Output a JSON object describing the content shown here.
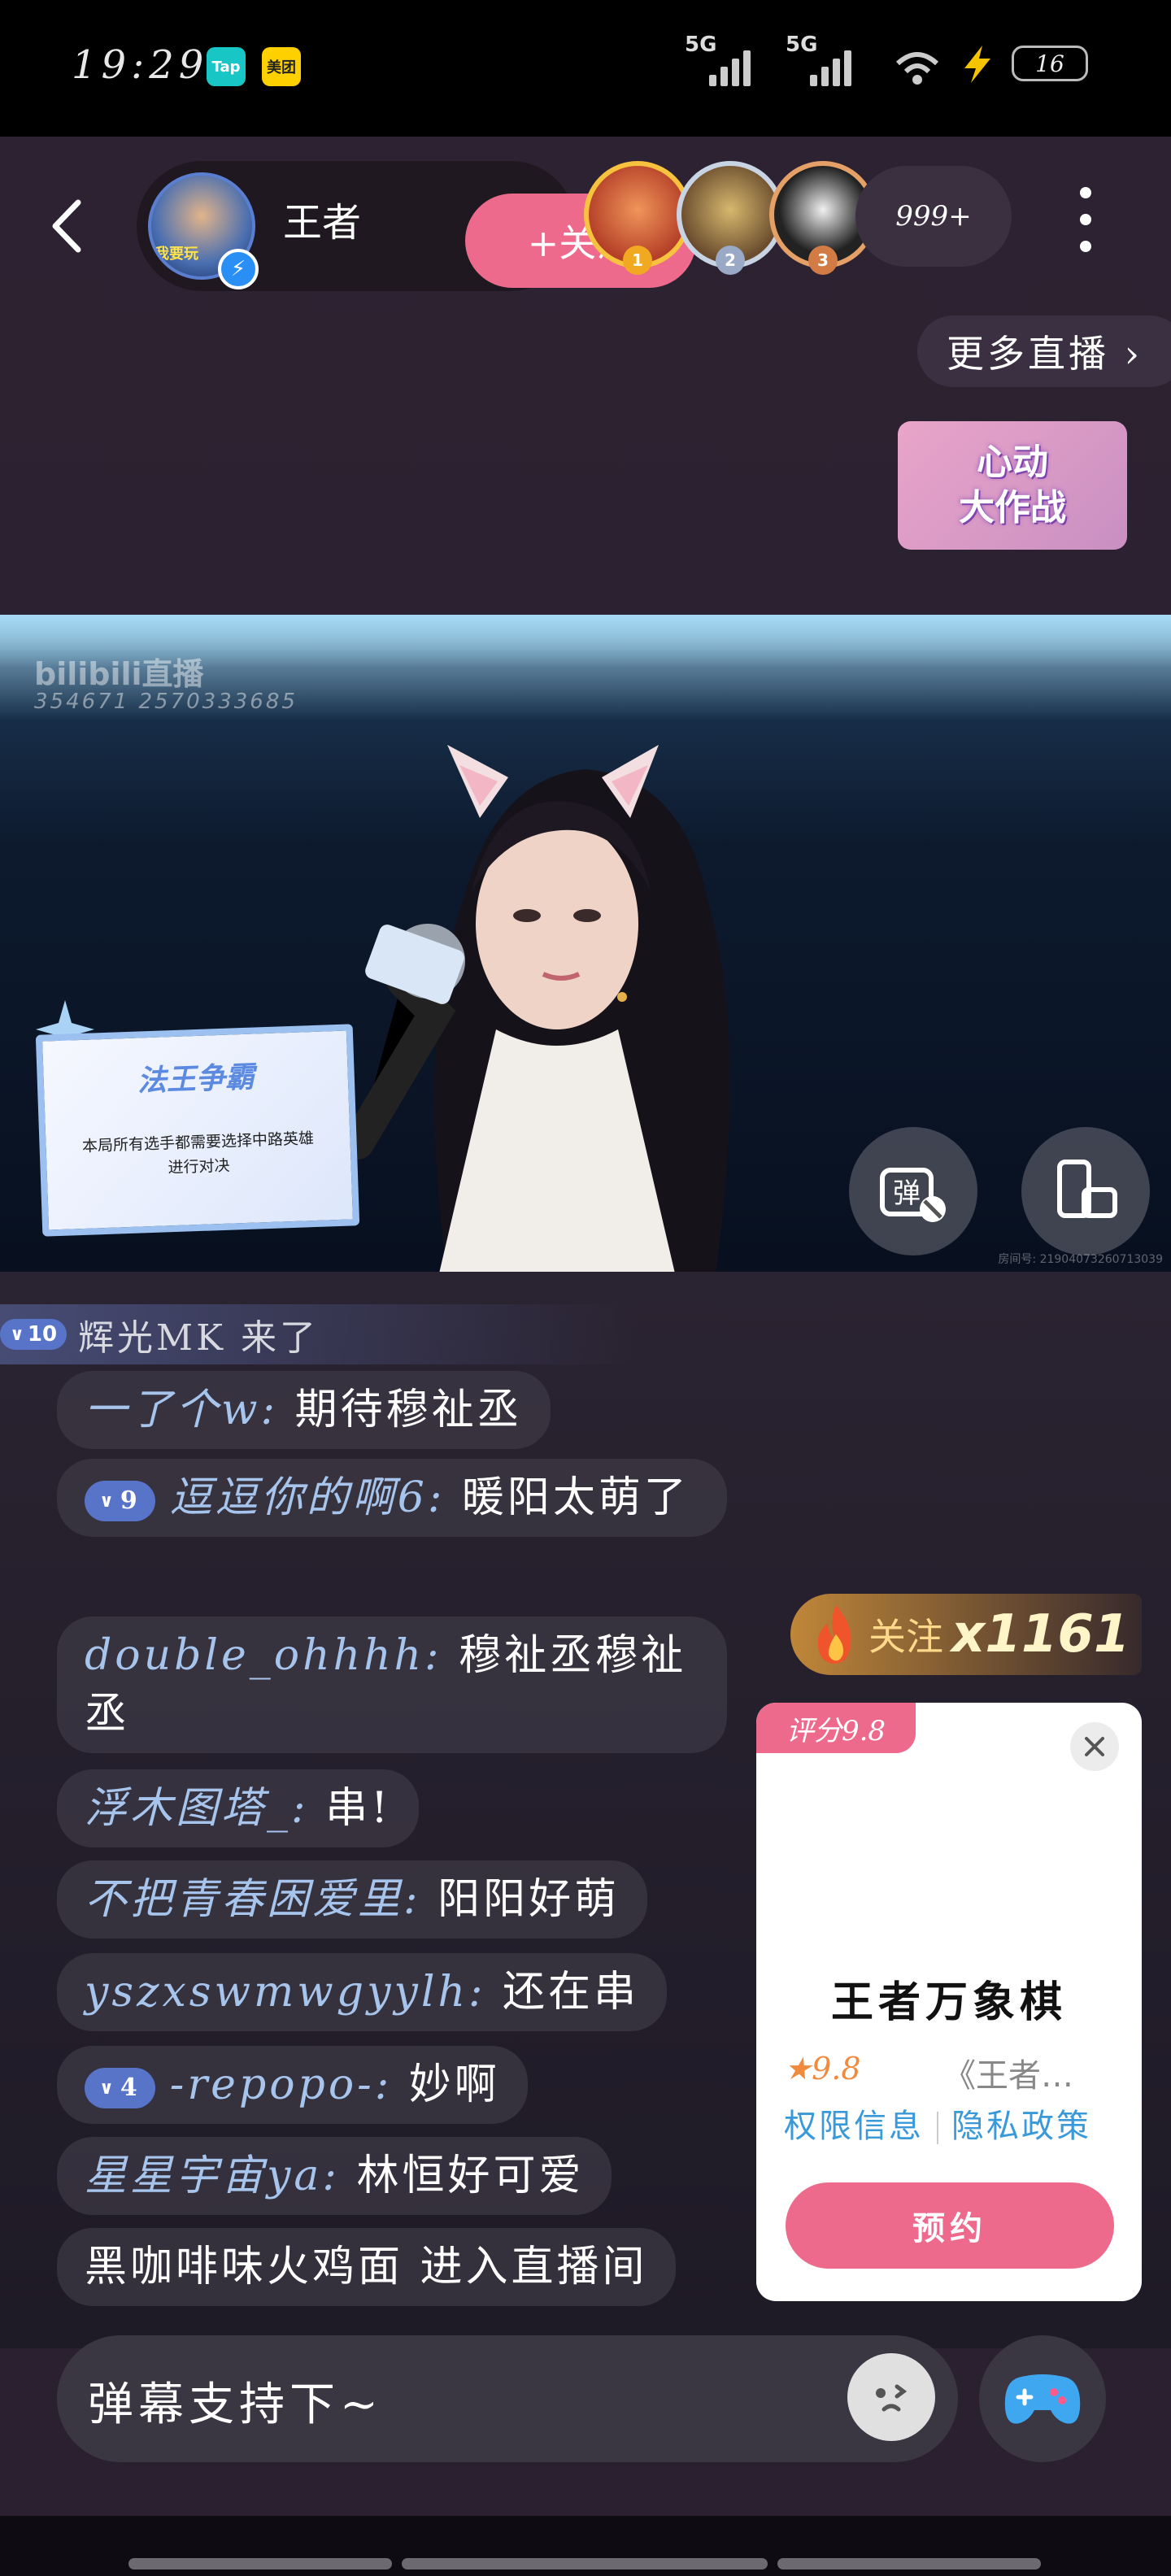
{
  "status_bar": {
    "time": "19:29",
    "apps": [
      "Tap",
      "美团"
    ],
    "network_1": "5G",
    "network_2": "5G",
    "battery": "16"
  },
  "header": {
    "host_name": "王者",
    "host_avatar_tag": "我要玩",
    "follow_label": "+关注",
    "rank": [
      "1",
      "2",
      "3"
    ],
    "viewer_count": "999+",
    "more_live_label": "更多直播 ›",
    "activity_banner": [
      "心动",
      "大作战"
    ]
  },
  "video": {
    "platform_watermark": "bilibili直播",
    "room_id_watermark": "354671 2570333685",
    "card_title": "法王争霸",
    "card_body": "本局所有选手都需要选择中路英雄进行对决",
    "room_no_watermark": "房间号: 21904073260713039"
  },
  "chat": {
    "enter_notice": {
      "level": "10",
      "text": "辉光MK 来了"
    },
    "messages": [
      {
        "user": "一了个w:",
        "text": "期待穆祉丞"
      },
      {
        "level": "9",
        "user": "逗逗你的啊6:",
        "text": "暖阳太萌了"
      },
      {
        "user": "double_ohhhh:",
        "text": "穆祉丞穆祉丞"
      },
      {
        "user": "浮木图塔_:",
        "text": "串!"
      },
      {
        "user": "不把青春困爱里:",
        "text": "阳阳好萌"
      },
      {
        "user": "yszxswmwgyylh:",
        "text": "还在串"
      },
      {
        "level": "4",
        "user": "-repopo-:",
        "text": "妙啊"
      },
      {
        "user": "星星宇宙ya:",
        "text": "林恒好可爱"
      },
      {
        "user": "",
        "text": "黑咖啡味火鸡面 进入直播间"
      }
    ]
  },
  "follow_combo": {
    "label": "关注",
    "count": "x1161"
  },
  "game_card": {
    "score": "评分9.8",
    "title": "王者万象棋",
    "rating": "9.8",
    "desc": "《王者…",
    "link_permissions": "权限信息",
    "link_privacy": "隐私政策",
    "reserve_label": "预约"
  },
  "input": {
    "placeholder": "弹幕支持下~"
  },
  "colors": {
    "accent_pink": "#ee6a8c",
    "level_badge": "#5874c8",
    "background": "#2a2030"
  }
}
